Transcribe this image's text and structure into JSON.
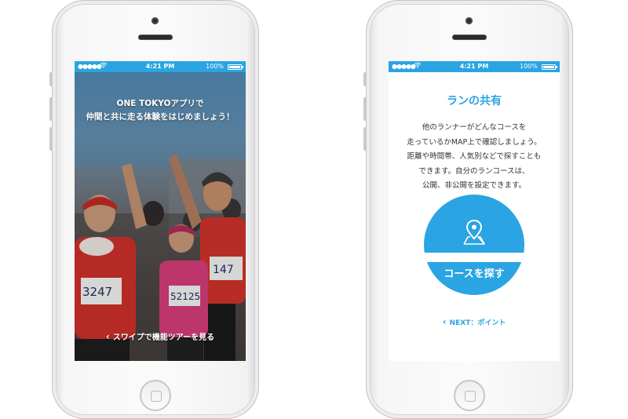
{
  "status_bar": {
    "signal": "●●●●●",
    "time": "4:21 PM",
    "battery_text": "100%"
  },
  "intro_screen": {
    "title": "ONE TOKYOアプリで\n仲間と共に走る体験をはじめましょう！",
    "swipe_text": "スワイプで機能ツアーを見る"
  },
  "share_screen": {
    "title": "ランの共有",
    "body": "他のランナーがどんなコースを\n走っているかMAP上で確認しましょう。\n距離や時間帯、人気別などで探すことも\nできます。自分のランコースは、\n公開、非公開を設定できます。",
    "search_button_label": "コースを探す",
    "next_label": "NEXT：ポイント"
  },
  "colors": {
    "accent": "#2aa4e2",
    "status_bar": "#2aa4e2"
  }
}
